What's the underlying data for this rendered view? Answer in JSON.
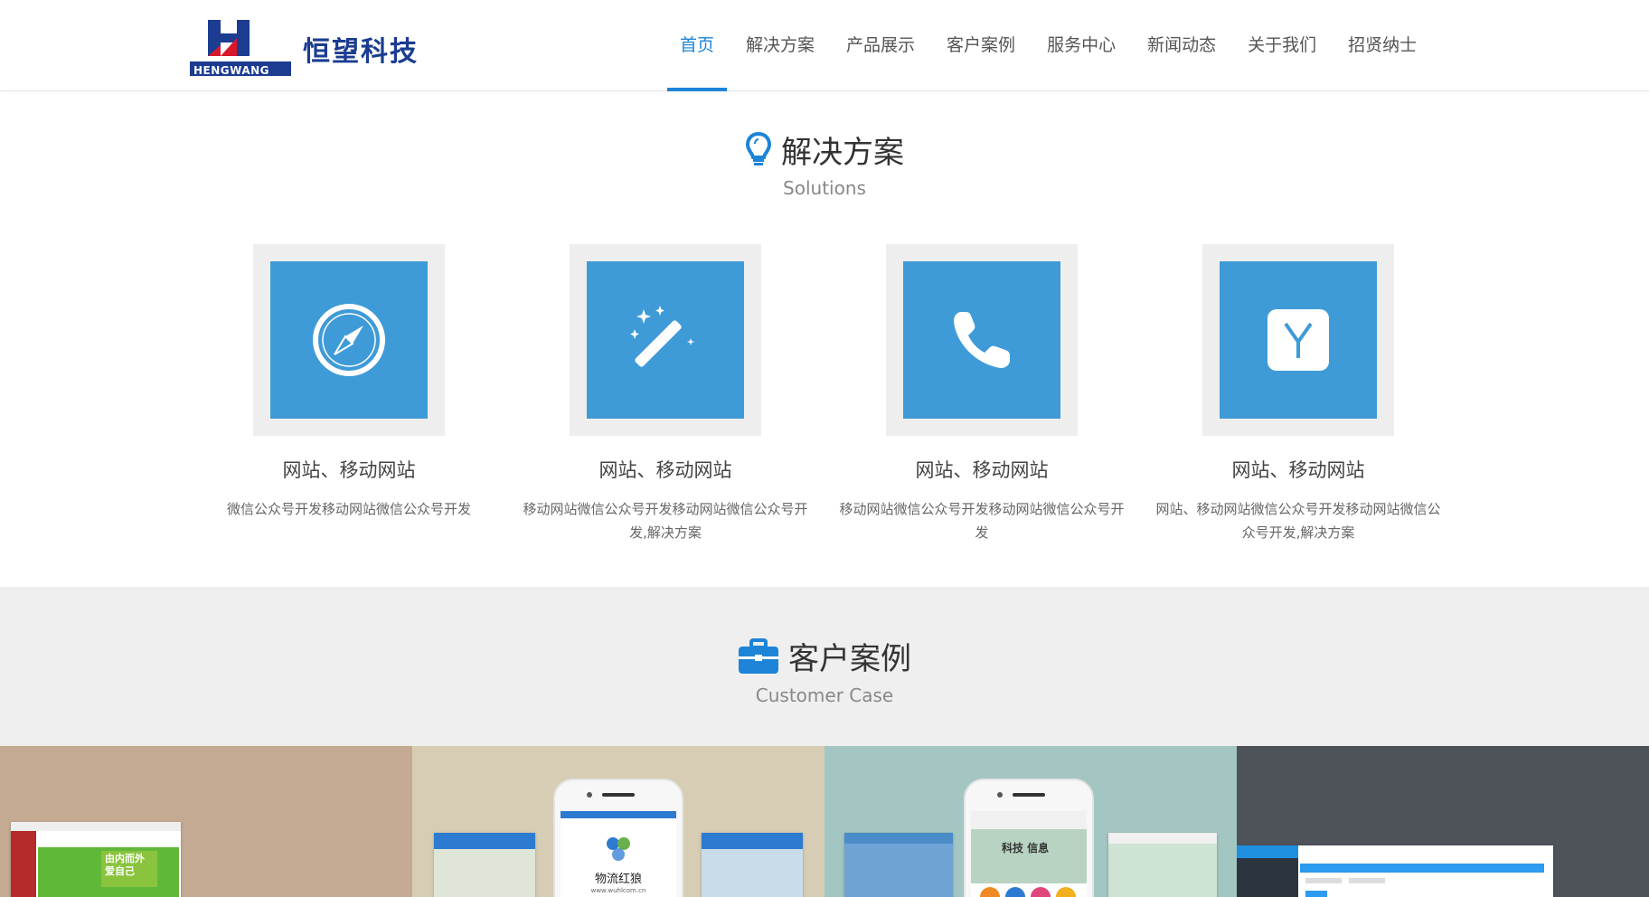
{
  "header": {
    "logo_text": "恒望科技",
    "logo_sub": "HENGWANG",
    "nav": [
      {
        "label": "首页",
        "active": true
      },
      {
        "label": "解决方案",
        "active": false
      },
      {
        "label": "产品展示",
        "active": false
      },
      {
        "label": "客户案例",
        "active": false
      },
      {
        "label": "服务中心",
        "active": false
      },
      {
        "label": "新闻动态",
        "active": false
      },
      {
        "label": "关于我们",
        "active": false
      },
      {
        "label": "招贤纳士",
        "active": false
      }
    ]
  },
  "solutions": {
    "title": "解决方案",
    "subtitle": "Solutions",
    "title_icon": "lightbulb-icon",
    "items": [
      {
        "icon": "compass-icon",
        "title": "网站、移动网站",
        "desc": "微信公众号开发移动网站微信公众号开发"
      },
      {
        "icon": "magic-wand-icon",
        "title": "网站、移动网站",
        "desc": "移动网站微信公众号开发移动网站微信公众号开发,解决方案"
      },
      {
        "icon": "phone-icon",
        "title": "网站、移动网站",
        "desc": "移动网站微信公众号开发移动网站微信公众号开发"
      },
      {
        "icon": "yahoo-icon",
        "title": "网站、移动网站",
        "desc": "网站、移动网站微信公众号开发移动网站微信公众号开发,解决方案"
      }
    ]
  },
  "cases": {
    "title": "客户案例",
    "subtitle": "Customer Case",
    "title_icon": "briefcase-icon",
    "thumbs": [
      {
        "bg": "#c4aa92",
        "caption": "由内而外 爱自己"
      },
      {
        "bg": "#d6cdb4",
        "caption": "物流红狼",
        "caption_sub": "www.wuhlcom.cn"
      },
      {
        "bg": "#a4c6c2",
        "caption": "科技 信息"
      },
      {
        "bg": "#4e5259",
        "caption": ""
      }
    ]
  },
  "colors": {
    "accent": "#1d84d8",
    "tile": "#3e9bd8",
    "logo": "#1b3c91"
  }
}
